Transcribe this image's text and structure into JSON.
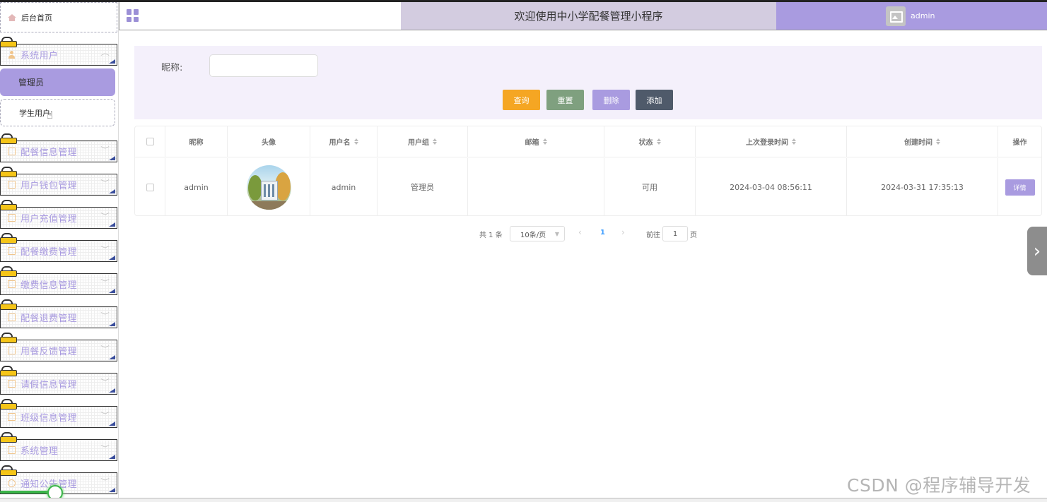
{
  "sidebar": {
    "home_label": "后台首页",
    "groups": [
      {
        "label": "系统用户",
        "icon": "person-icon"
      },
      {
        "label": "配餐信息管理",
        "icon": "edit-icon"
      },
      {
        "label": "用户钱包管理",
        "icon": "edit-icon"
      },
      {
        "label": "用户充值管理",
        "icon": "edit-icon"
      },
      {
        "label": "配餐缴费管理",
        "icon": "edit-icon"
      },
      {
        "label": "缴费信息管理",
        "icon": "edit-icon"
      },
      {
        "label": "配餐退费管理",
        "icon": "edit-icon"
      },
      {
        "label": "用餐反馈管理",
        "icon": "edit-icon"
      },
      {
        "label": "请假信息管理",
        "icon": "edit-icon"
      },
      {
        "label": "班级信息管理",
        "icon": "edit-icon"
      },
      {
        "label": "系统管理",
        "icon": "image-icon"
      },
      {
        "label": "通知公告管理",
        "icon": "info-icon"
      }
    ],
    "sub_items": [
      {
        "label": "管理员",
        "active": true
      },
      {
        "label": "学生用户",
        "active": false
      }
    ]
  },
  "header": {
    "title": "欢迎使用中小学配餐管理小程序",
    "user_name": "admin"
  },
  "search": {
    "nickname_label": "昵称:",
    "nickname_value": "",
    "buttons": {
      "query": "查询",
      "reset": "重置",
      "delete": "删除",
      "add": "添加"
    }
  },
  "table": {
    "columns": [
      "",
      "昵称",
      "头像",
      "用户名",
      "用户组",
      "邮箱",
      "状态",
      "上次登录时间",
      "创建时间",
      "操作"
    ],
    "rows": [
      {
        "nickname": "admin",
        "username": "admin",
        "group": "管理员",
        "email": "",
        "status": "可用",
        "last_login": "2024-03-04 08:56:11",
        "created": "2024-03-31 17:35:13",
        "action": "详情"
      }
    ]
  },
  "pagination": {
    "total": "共 1 条",
    "page_size": "10条/页",
    "current_page": "1",
    "goto_label": "前往",
    "goto_value": "1",
    "page_suffix": "页"
  },
  "watermark": "CSDN @程序辅导开发",
  "colors": {
    "accent": "#a99be0",
    "header_mid": "#d3cce0",
    "query": "#f5a623",
    "reset": "#7fa07f",
    "add": "#4f5a6a"
  }
}
